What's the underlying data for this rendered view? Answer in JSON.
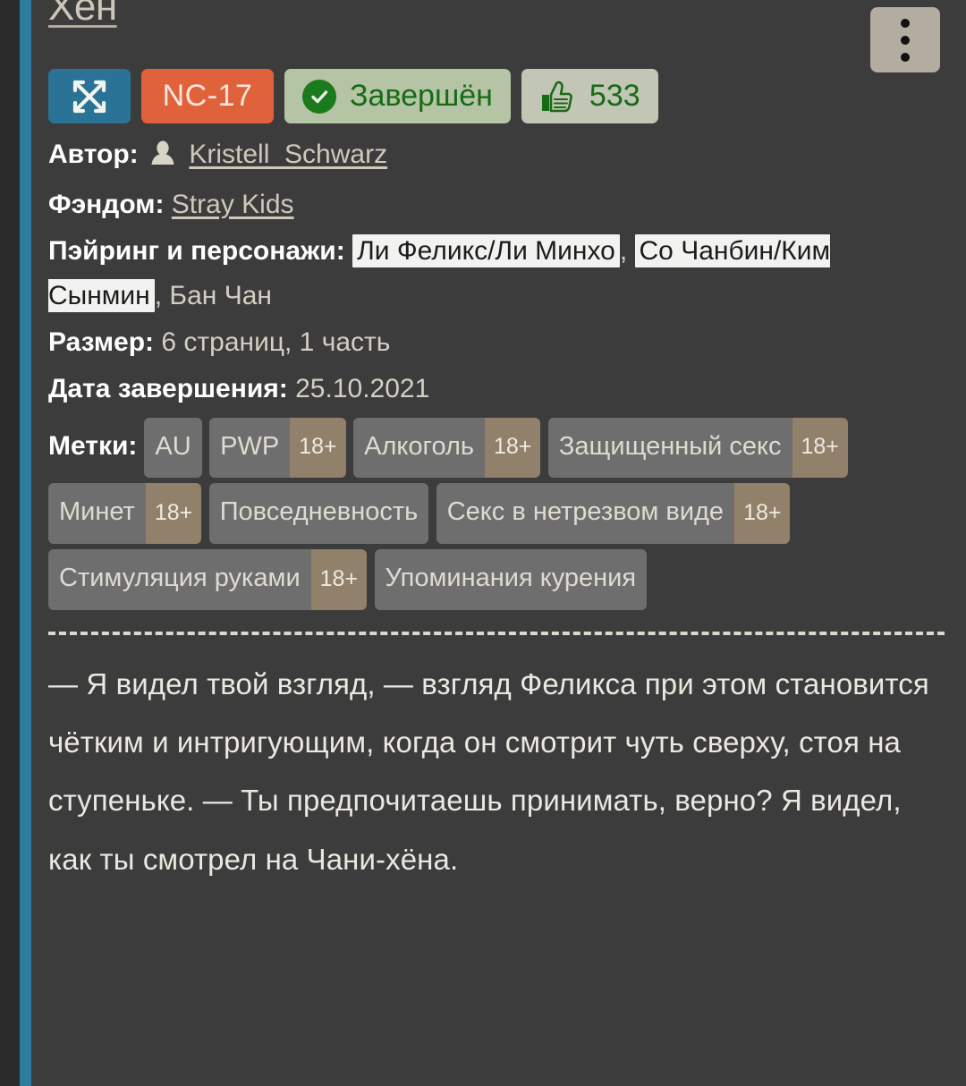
{
  "work": {
    "title": "Хён",
    "menu_icon": "kebab-menu-icon"
  },
  "badges": {
    "category_icon": "crossed-arrows-icon",
    "rating": "NC-17",
    "status_icon": "check-circle-icon",
    "status": "Завершён",
    "likes_icon": "thumbs-up-icon",
    "likes": "533"
  },
  "meta": {
    "author_label": "Автор:",
    "author_icon": "person-icon",
    "author_name": "Kristell_Schwarz",
    "fandom_label": "Фэндом:",
    "fandom_value": "Stray Kids",
    "pairing_label": "Пэйринг и персонажи:",
    "pairings": [
      "Ли Феликс/Ли Минхо",
      "Со Чанбин/Ким Сынмин"
    ],
    "pairing_extra": "Бан Чан",
    "separator": ", ",
    "size_label": "Размер:",
    "size_value": "6 страниц, 1 часть",
    "date_label": "Дата завершения:",
    "date_value": "25.10.2021"
  },
  "tags": {
    "label": "Метки:",
    "age_marker": "18+",
    "items": [
      {
        "name": "AU",
        "adult": false
      },
      {
        "name": "PWP",
        "adult": true
      },
      {
        "name": "Алкоголь",
        "adult": true
      },
      {
        "name": "Защищенный секс",
        "adult": true
      },
      {
        "name": "Минет",
        "adult": true
      },
      {
        "name": "Повседневность",
        "adult": false
      },
      {
        "name": "Секс в нетрезвом виде",
        "adult": true
      },
      {
        "name": "Стимуляция руками",
        "adult": true
      },
      {
        "name": "Упоминания курения",
        "adult": false
      }
    ]
  },
  "body": {
    "text": "— Я видел твой взгляд, — взгляд Феликса при этом становится чётким и интригующим, когда он смотрит чуть сверху, стоя на ступеньке. — Ты предпочитаешь принимать, верно? Я видел, как ты смотрел на Чани-хёна."
  },
  "colors": {
    "page_background": "#2e2e2e",
    "content_background": "#3c3c3c",
    "accent_stripe": "#2e7d9e",
    "rating_badge": "#e0623a",
    "status_badge": "#b4c4a4",
    "status_text": "#176b17",
    "likes_badge": "#c2c6b4",
    "category_badge": "#2a7397",
    "tag_background": "#6e6e6e",
    "tag_age_background": "#91806a",
    "title_text": "#cdc7b8",
    "body_text": "#ebe8e1"
  }
}
